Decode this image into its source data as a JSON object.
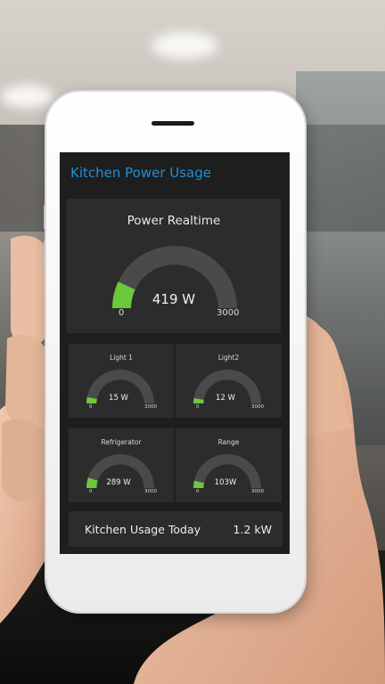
{
  "app": {
    "title": "Kitchen Power Usage"
  },
  "main_gauge": {
    "title": "Power Realtime",
    "value_text": "419 W",
    "min_label": "0",
    "max_label": "3000",
    "fraction": 0.14
  },
  "gauges": [
    {
      "title": "Light 1",
      "value_text": "15 W",
      "min_label": "0",
      "max_label": "3000",
      "fraction": 0.06
    },
    {
      "title": "Light2",
      "value_text": "12 W",
      "min_label": "0",
      "max_label": "3000",
      "fraction": 0.05
    },
    {
      "title": "Refrigerator",
      "value_text": "289 W",
      "min_label": "0",
      "max_label": "3000",
      "fraction": 0.1
    },
    {
      "title": "Range",
      "value_text": "103W",
      "min_label": "0",
      "max_label": "3000",
      "fraction": 0.07
    }
  ],
  "usage": {
    "label": "Kitchen Usage Today",
    "value": "1.2 kW"
  },
  "colors": {
    "accent": "#1f8fd8",
    "gauge_fill": "#6cc83c",
    "gauge_track": "#4a4a4a",
    "card": "#2c2c2c",
    "screen": "#1e1e1e"
  }
}
